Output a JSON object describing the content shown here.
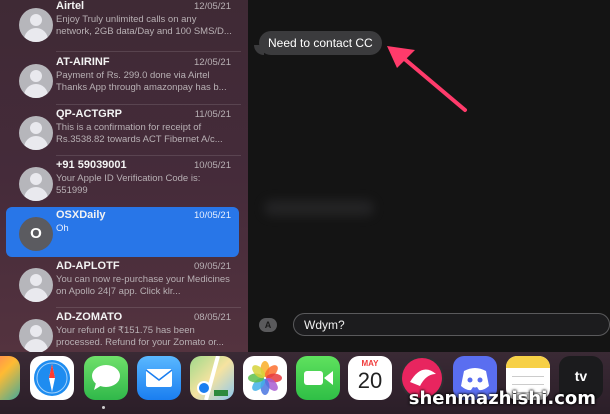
{
  "conversations": [
    {
      "name": "Airtel",
      "date": "12/05/21",
      "preview": "Enjoy Truly unlimited calls on any network, 2GB data/Day and 100 SMS/D..."
    },
    {
      "name": "AT-AIRINF",
      "date": "12/05/21",
      "preview": "Payment of Rs. 299.0 done via Airtel Thanks App through amazonpay has b..."
    },
    {
      "name": "QP-ACTGRP",
      "date": "11/05/21",
      "preview": "This is a confirmation for receipt of Rs.3538.82 towards ACT Fibernet A/c..."
    },
    {
      "name": "+91 59039001",
      "date": "10/05/21",
      "preview": "Your Apple ID Verification Code is: 551999"
    },
    {
      "name": "OSXDaily",
      "date": "10/05/21",
      "preview": "Oh",
      "initial": "O",
      "selected": true
    },
    {
      "name": "AD-APLOTF",
      "date": "09/05/21",
      "preview": "You can now re-purchase your Medicines on Apollo 24|7 app. Click klr..."
    },
    {
      "name": "AD-ZOMATO",
      "date": "08/05/21",
      "preview": "Your refund of ₹151.75 has been processed. Refund for your Zomato or..."
    }
  ],
  "chat": {
    "message": "Need to contact CC",
    "input_value": "Wdym?",
    "apps_icon": "A"
  },
  "dock": {
    "calendar_month": "MAY",
    "calendar_day": "20",
    "apps": [
      "launchpad-icon",
      "safari-icon",
      "messages-icon",
      "mail-icon",
      "maps-icon",
      "photos-icon",
      "facetime-icon",
      "calendar-icon",
      "skitch-icon",
      "discord-icon",
      "notes-icon",
      "appletv-icon"
    ],
    "appletv_label": "tv"
  },
  "watermark": "shenmazhishi.com",
  "colors": {
    "selection": "#2876e8",
    "annotation_arrow": "#ff3b6b",
    "bubble": "#3b3b3d"
  }
}
